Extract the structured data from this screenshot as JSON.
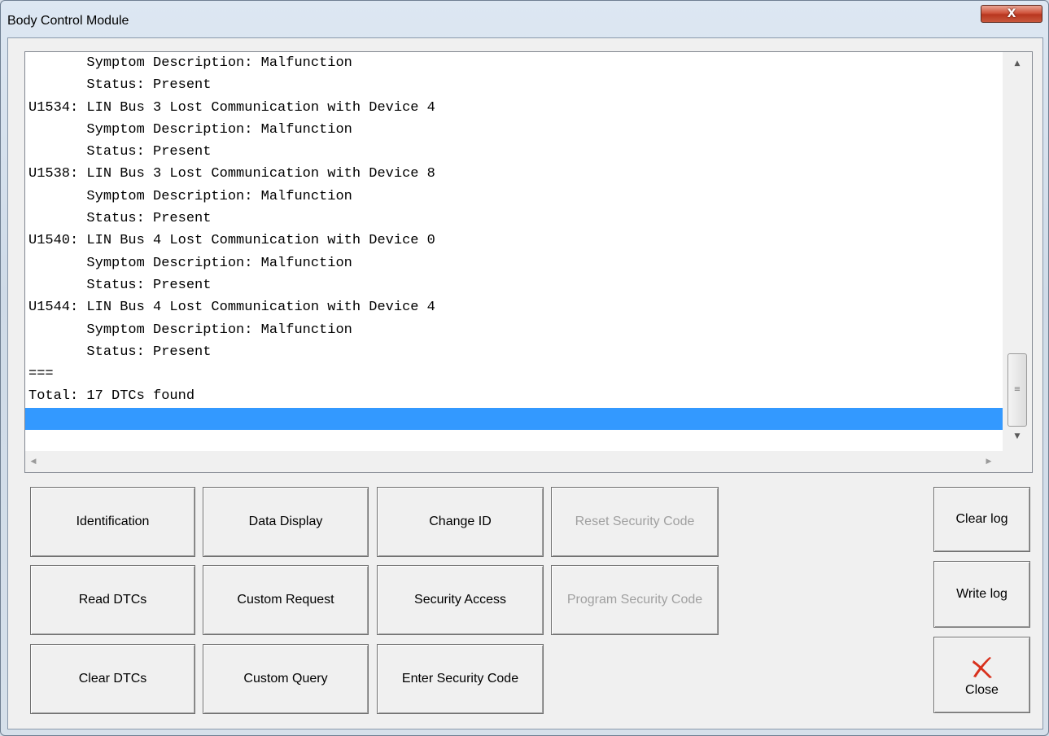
{
  "window": {
    "title": "Body Control Module",
    "close_glyph": "X"
  },
  "log": {
    "lines": [
      "       Symptom Description: Malfunction",
      "       Status: Present",
      "U1534: LIN Bus 3 Lost Communication with Device 4",
      "       Symptom Description: Malfunction",
      "       Status: Present",
      "U1538: LIN Bus 3 Lost Communication with Device 8",
      "       Symptom Description: Malfunction",
      "       Status: Present",
      "U1540: LIN Bus 4 Lost Communication with Device 0",
      "       Symptom Description: Malfunction",
      "       Status: Present",
      "U1544: LIN Bus 4 Lost Communication with Device 4",
      "       Symptom Description: Malfunction",
      "       Status: Present",
      "===",
      "Total: 17 DTCs found",
      "",
      ""
    ],
    "selected_line_index": 16,
    "scrollbar": {
      "up_arrow_icon": "▲",
      "down_arrow_icon": "▼",
      "thumb_grip_icon": "≡",
      "left_arrow_icon": "◀",
      "right_arrow_icon": "▶"
    }
  },
  "buttons": {
    "identification": "Identification",
    "data_display": "Data Display",
    "change_id": "Change ID",
    "reset_security_code": "Reset Security Code",
    "read_dtcs": "Read DTCs",
    "custom_request": "Custom Request",
    "security_access": "Security Access",
    "program_security_code": "Program Security Code",
    "clear_dtcs": "Clear DTCs",
    "custom_query": "Custom Query",
    "enter_security_code": "Enter Security Code",
    "clear_log": "Clear log",
    "write_log": "Write log",
    "close": "Close"
  },
  "colors": {
    "selection": "#3399ff",
    "disabled_text": "#a0a0a0",
    "close_icon": "#d8301c"
  }
}
